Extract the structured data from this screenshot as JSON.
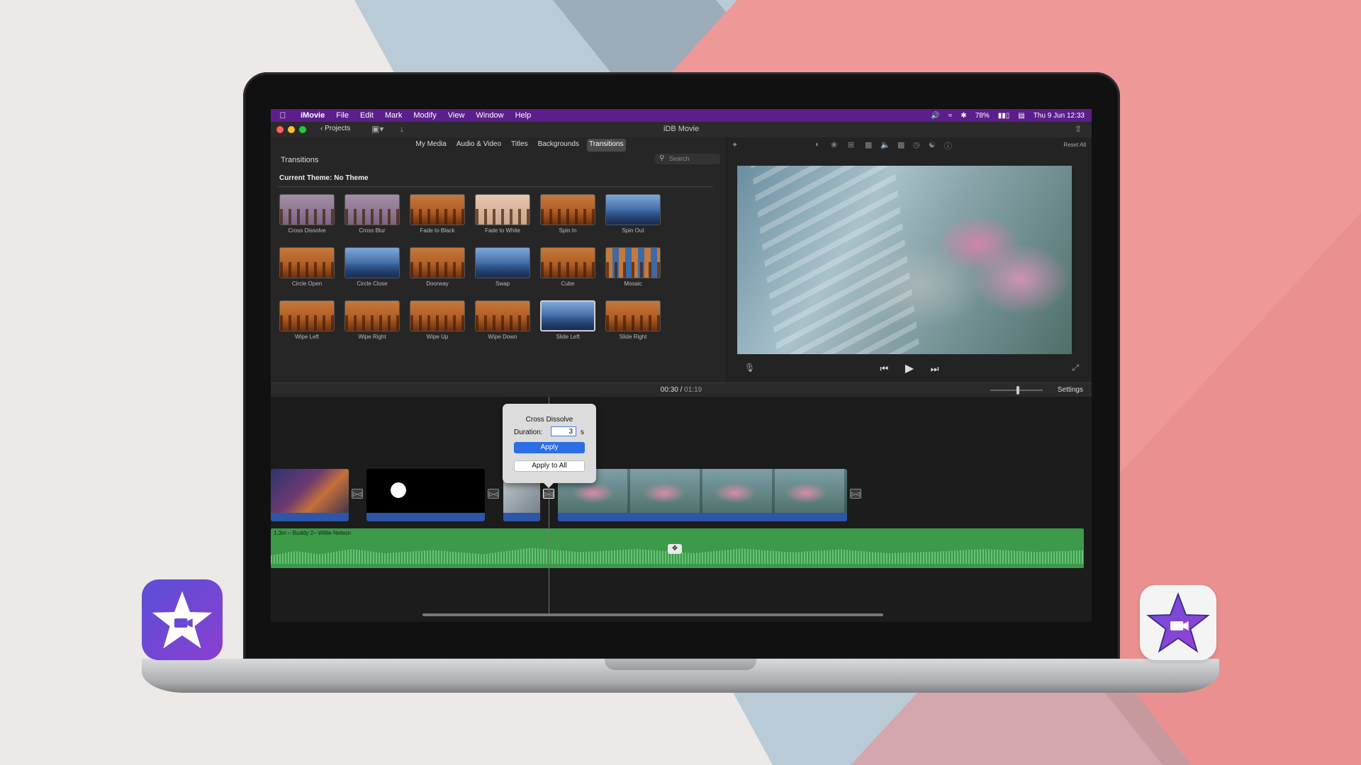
{
  "menubar": {
    "app_name": "iMovie",
    "items": [
      "File",
      "Edit",
      "Mark",
      "Modify",
      "View",
      "Window",
      "Help"
    ],
    "battery": "78%",
    "datetime": "Thu 9 Jun  12:33"
  },
  "titlebar": {
    "projects_label": "Projects",
    "title": "iDB Movie"
  },
  "browser": {
    "tabs": [
      "My Media",
      "Audio & Video",
      "Titles",
      "Backgrounds",
      "Transitions"
    ],
    "active_tab": "Transitions",
    "panel_title": "Transitions",
    "search_placeholder": "Search",
    "theme_label": "Current Theme: No Theme",
    "transitions": [
      "Cross Dissolve",
      "Cross Blur",
      "Fade to Black",
      "Fade to White",
      "Spin In",
      "Spin Out",
      "Circle Open",
      "Circle Close",
      "Doorway",
      "Swap",
      "Cube",
      "Mosaic",
      "Wipe Left",
      "Wipe Right",
      "Wipe Up",
      "Wipe Down",
      "Slide Left",
      "Slide Right"
    ],
    "selected_transition": "Slide Left"
  },
  "viewer": {
    "reset_label": "Reset All"
  },
  "timeline": {
    "current_time": "00:30",
    "separator": "/",
    "total_time": "01:19",
    "settings_label": "Settings",
    "audio_label": "1.3m – Buddy 2– Willie Nelson"
  },
  "popover": {
    "title": "Cross Dissolve",
    "duration_label": "Duration:",
    "duration_value": "3",
    "unit": "s",
    "apply_label": "Apply",
    "apply_all_label": "Apply to All"
  },
  "colors": {
    "menubar": "#5b1e8a",
    "accent_blue": "#2b6ee6",
    "audio_green": "#3c9a48"
  },
  "icons": [
    "apple-icon",
    "volume-icon",
    "wifi-icon",
    "bluetooth-icon",
    "battery-icon",
    "control-center-icon",
    "chevron-left-icon",
    "search-icon",
    "microphone-icon",
    "skip-back-icon",
    "play-icon",
    "skip-forward-icon",
    "fullscreen-icon",
    "share-icon",
    "turtle-icon",
    "imovie-star-icon"
  ]
}
